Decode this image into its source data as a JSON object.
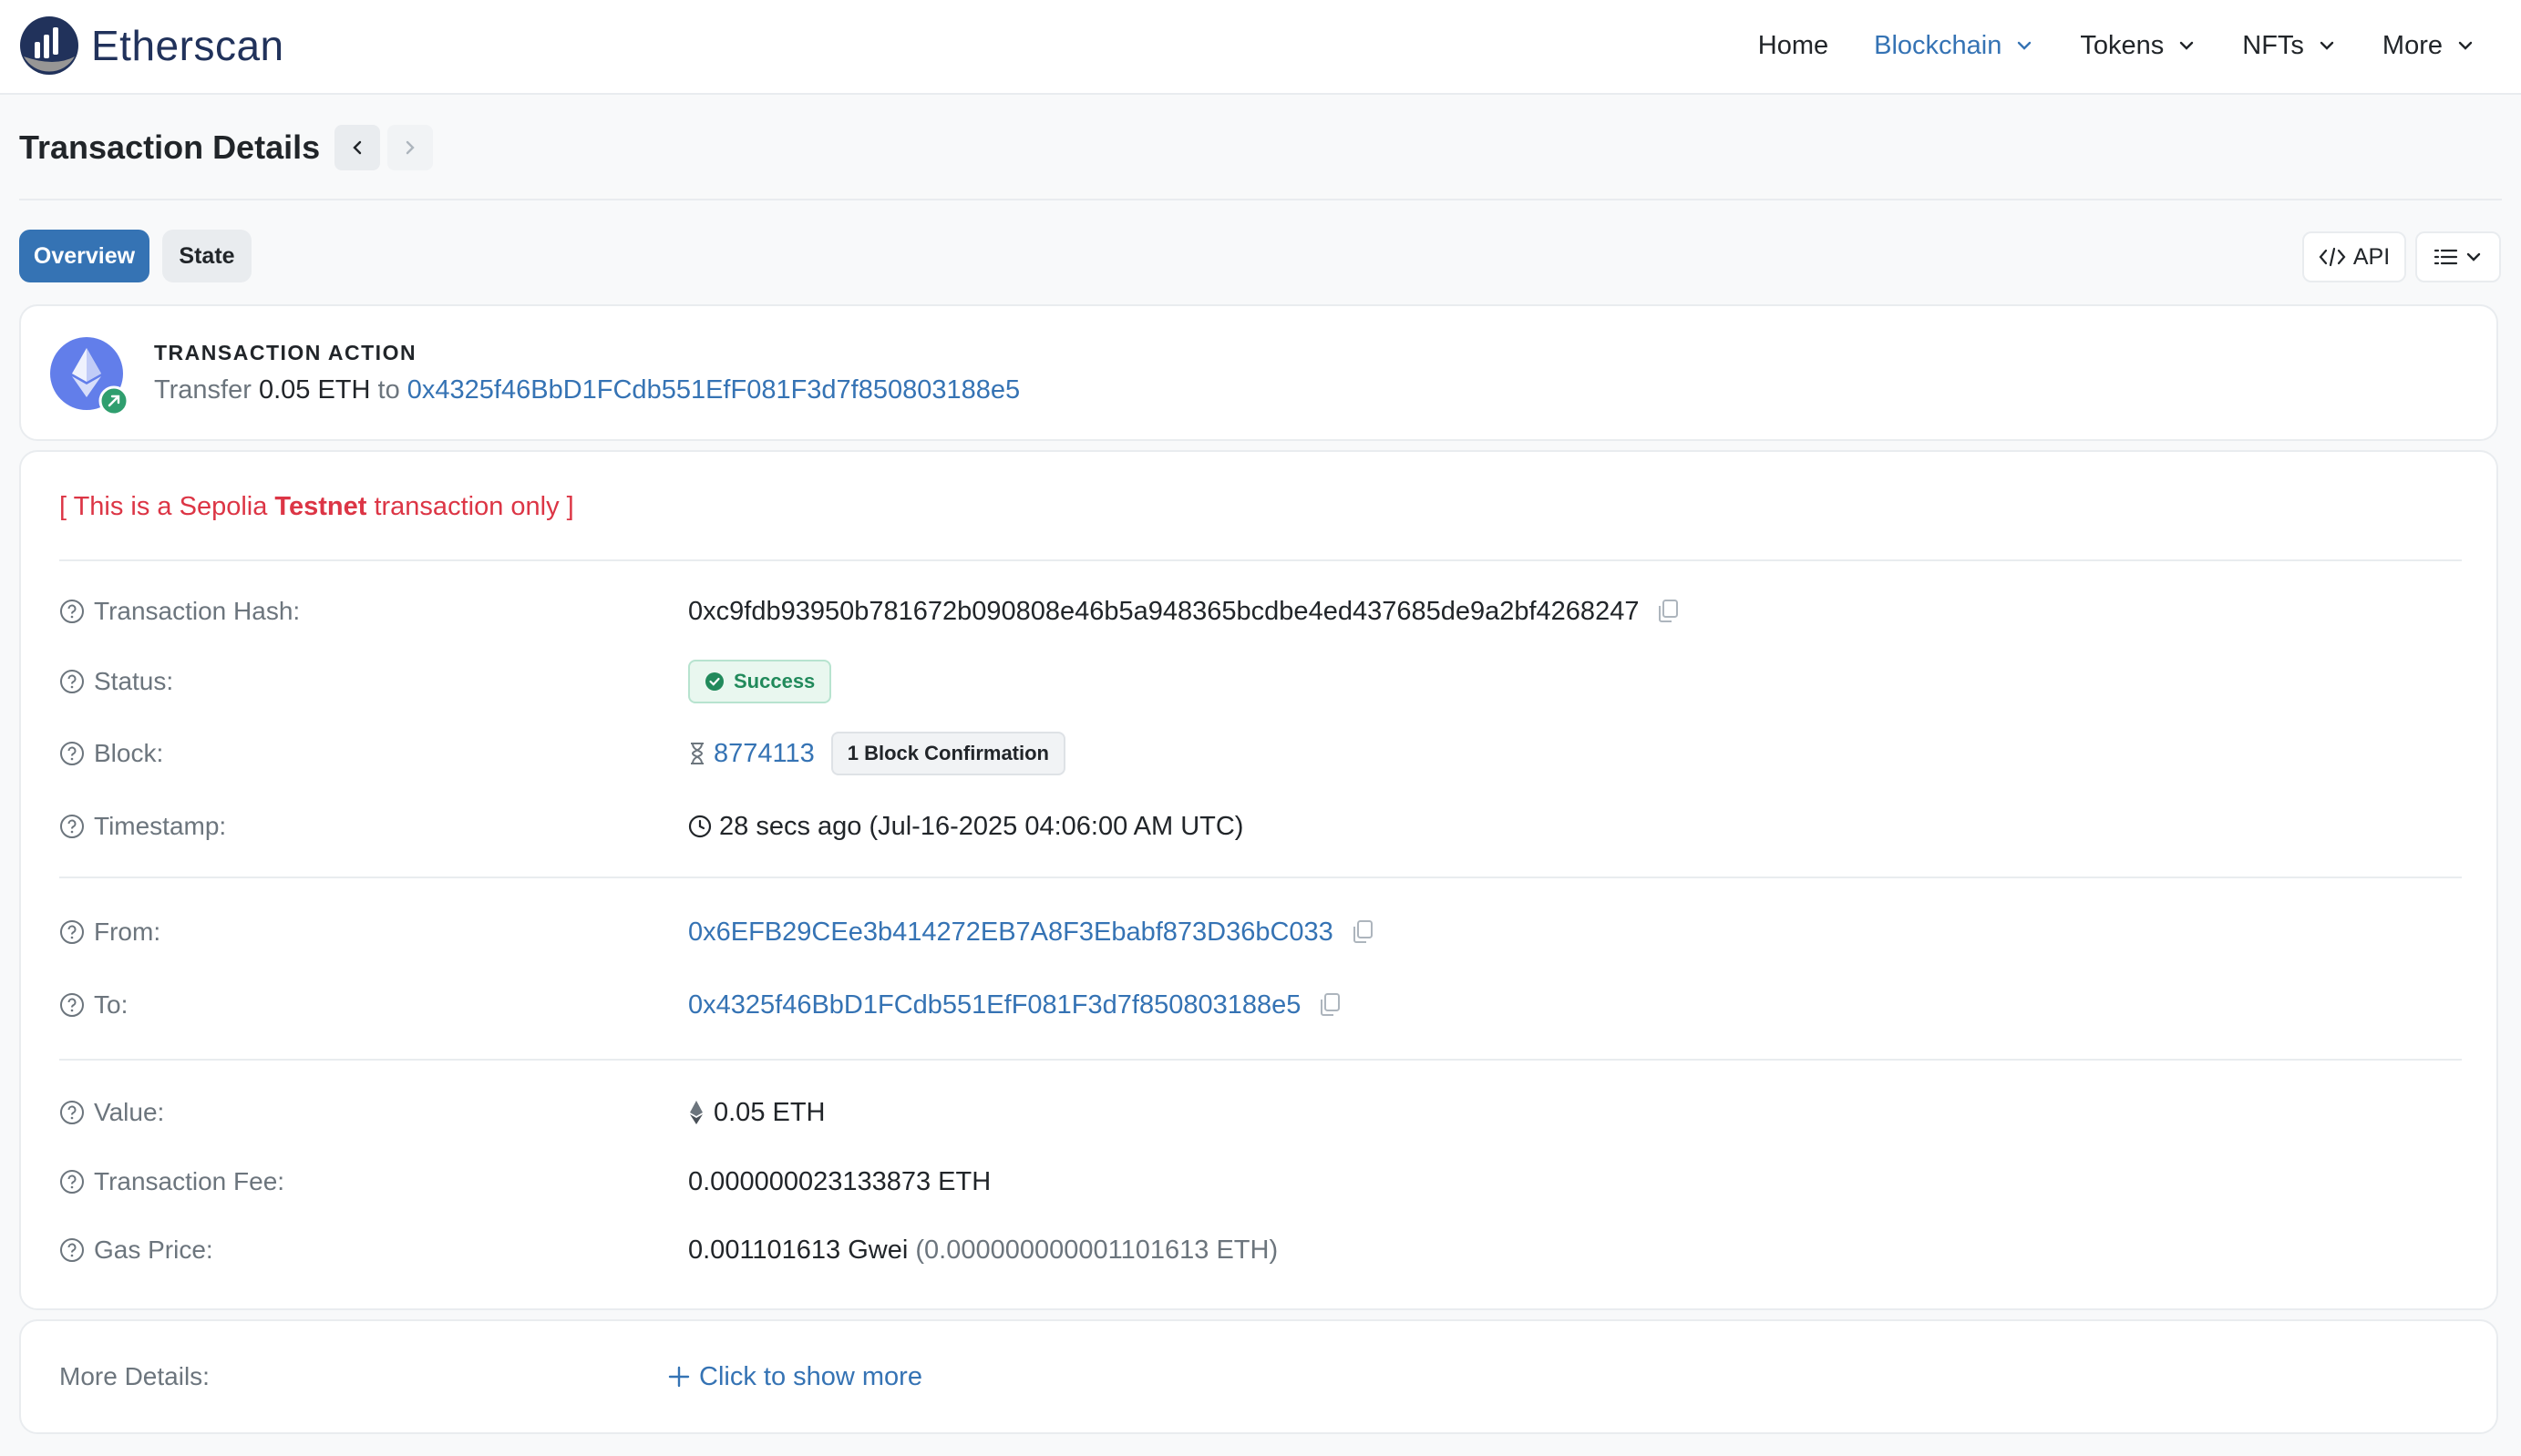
{
  "header": {
    "brand": "Etherscan",
    "nav": [
      {
        "label": "Home"
      },
      {
        "label": "Blockchain"
      },
      {
        "label": "Tokens"
      },
      {
        "label": "NFTs"
      },
      {
        "label": "More"
      }
    ]
  },
  "page": {
    "title": "Transaction Details",
    "tabs": [
      {
        "label": "Overview"
      },
      {
        "label": "State"
      }
    ],
    "api_label": "API"
  },
  "action": {
    "heading": "TRANSACTION ACTION",
    "verb": "Transfer",
    "amount": "0.05 ETH",
    "to_word": "to",
    "to_address": "0x4325f46BbD1FCdb551EfF081F3d7f850803188e5"
  },
  "notice": {
    "prefix": "[ This is a Sepolia ",
    "bold": "Testnet",
    "suffix": " transaction only ]"
  },
  "details": {
    "hash_label": "Transaction Hash:",
    "hash": "0xc9fdb93950b781672b090808e46b5a948365bcdbe4ed437685de9a2bf4268247",
    "status_label": "Status:",
    "status": "Success",
    "block_label": "Block:",
    "block": "8774113",
    "confirmations": "1 Block Confirmation",
    "timestamp_label": "Timestamp:",
    "timestamp": "28 secs ago (Jul-16-2025 04:06:00 AM UTC)",
    "from_label": "From:",
    "from": "0x6EFB29CEe3b414272EB7A8F3Ebabf873D36bC033",
    "to_label": "To:",
    "to": "0x4325f46BbD1FCdb551EfF081F3d7f850803188e5",
    "value_label": "Value:",
    "value": "0.05 ETH",
    "fee_label": "Transaction Fee:",
    "fee": "0.000000023133873 ETH",
    "gas_label": "Gas Price:",
    "gas": "0.001101613 Gwei",
    "gas_eth": "(0.000000000001101613 ETH)"
  },
  "more": {
    "label": "More Details:",
    "link": "Click to show more"
  },
  "colors": {
    "brand": "#21325b",
    "accent": "#3573b4",
    "success": "#218a5b",
    "danger": "#dc3545"
  }
}
